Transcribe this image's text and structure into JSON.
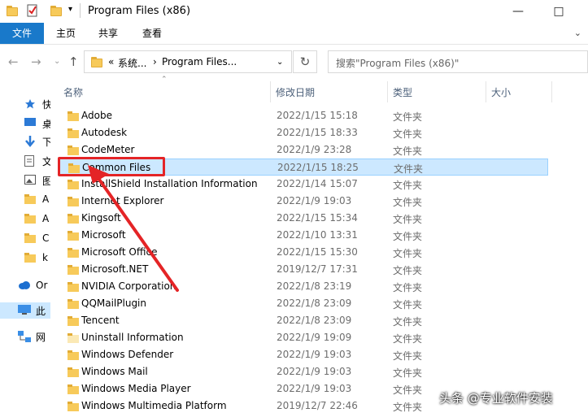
{
  "window": {
    "title": "Program Files (x86)"
  },
  "ribbon": {
    "tabs": [
      "文件",
      "主页",
      "共享",
      "查看"
    ]
  },
  "address": {
    "prefix": "«",
    "crumbs": [
      "系统...",
      "Program Files..."
    ]
  },
  "search": {
    "placeholder": "搜索\"Program Files (x86)\""
  },
  "nav": {
    "items": [
      {
        "label": "快",
        "icon": "star-icon"
      },
      {
        "label": "桌",
        "icon": "desktop-icon"
      },
      {
        "label": "下",
        "icon": "download-icon"
      },
      {
        "label": "文",
        "icon": "document-icon"
      },
      {
        "label": "图",
        "icon": "picture-icon"
      },
      {
        "label": "A",
        "icon": "folder-icon"
      },
      {
        "label": "A",
        "icon": "folder-icon"
      },
      {
        "label": "C",
        "icon": "folder-icon"
      },
      {
        "label": "k",
        "icon": "folder-icon"
      },
      {
        "label": "Or",
        "icon": "cloud-icon"
      },
      {
        "label": "此",
        "icon": "pc-icon"
      },
      {
        "label": "网",
        "icon": "network-icon"
      }
    ]
  },
  "columns": {
    "name": "名称",
    "date": "修改日期",
    "type": "类型",
    "size": "大小"
  },
  "files": [
    {
      "name": "Adobe",
      "date": "2022/1/15 15:18",
      "type": "文件夹"
    },
    {
      "name": "Autodesk",
      "date": "2022/1/15 18:33",
      "type": "文件夹"
    },
    {
      "name": "CodeMeter",
      "date": "2022/1/9 23:28",
      "type": "文件夹"
    },
    {
      "name": "Common Files",
      "date": "2022/1/15 18:25",
      "type": "文件夹"
    },
    {
      "name": "InstallShield Installation Information",
      "date": "2022/1/14 15:07",
      "type": "文件夹"
    },
    {
      "name": "Internet Explorer",
      "date": "2022/1/9 19:03",
      "type": "文件夹"
    },
    {
      "name": "Kingsoft",
      "date": "2022/1/15 15:34",
      "type": "文件夹"
    },
    {
      "name": "Microsoft",
      "date": "2022/1/10 13:31",
      "type": "文件夹"
    },
    {
      "name": "Microsoft Office",
      "date": "2022/1/15 15:30",
      "type": "文件夹"
    },
    {
      "name": "Microsoft.NET",
      "date": "2019/12/7 17:31",
      "type": "文件夹"
    },
    {
      "name": "NVIDIA Corporation",
      "date": "2022/1/8 23:19",
      "type": "文件夹"
    },
    {
      "name": "QQMailPlugin",
      "date": "2022/1/8 23:09",
      "type": "文件夹"
    },
    {
      "name": "Tencent",
      "date": "2022/1/8 23:09",
      "type": "文件夹"
    },
    {
      "name": "Uninstall Information",
      "date": "2022/1/9 19:09",
      "type": "文件夹"
    },
    {
      "name": "Windows Defender",
      "date": "2022/1/9 19:03",
      "type": "文件夹"
    },
    {
      "name": "Windows Mail",
      "date": "2022/1/9 19:03",
      "type": "文件夹"
    },
    {
      "name": "Windows Media Player",
      "date": "2022/1/9 19:03",
      "type": "文件夹"
    },
    {
      "name": "Windows Multimedia Platform",
      "date": "2019/12/7 22:46",
      "type": "文件夹"
    }
  ],
  "selected_file": "Common Files",
  "watermark": "头条 @专业软件安装",
  "colors": {
    "accent": "#1979ca",
    "selection": "#cce8ff",
    "highlight": "#e42426"
  }
}
